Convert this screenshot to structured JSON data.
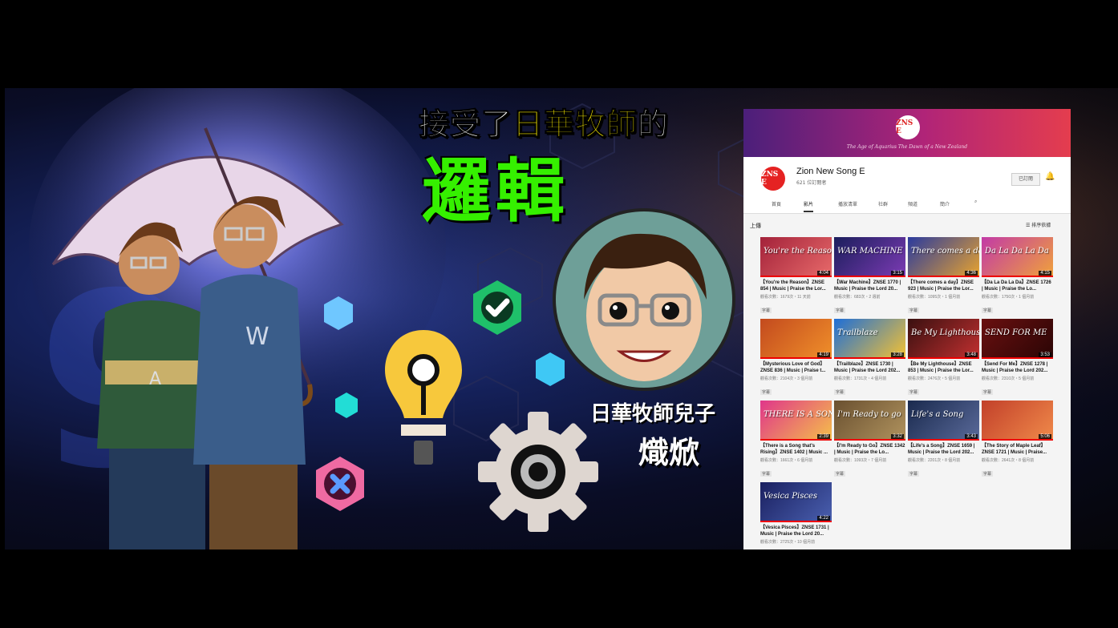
{
  "headline": {
    "part1": "接受了",
    "highlight": "日華牧師",
    "part2": "的",
    "big": "邏輯"
  },
  "creator": {
    "line1": "日華牧師兒子",
    "line2": "熾焮"
  },
  "colors": {
    "headline_highlight": "#f6e800",
    "big_title": "#35f000",
    "check_badge": "#1fc06a",
    "cross_badge": "#ef6aa2",
    "youtube_red": "#e52222"
  },
  "youtube": {
    "banner_logo": "ZNS E",
    "banner_tagline": "The Age of Aquarius  The Dawn of a New Zealand",
    "channel_logo": "ZNS E",
    "channel_name": "Zion New Song E",
    "subscribers": "621 位訂閱者",
    "subscribe_btn": "已訂閱",
    "tabs": [
      "首頁",
      "影片",
      "播放清單",
      "社群",
      "頻道",
      "簡介"
    ],
    "active_tab": "影片",
    "section": "上傳",
    "sort": "排序依據",
    "videos": [
      {
        "title": "【You're the Reason】ZNSE 854 | Music | Praise the Lor...",
        "meta": "觀看次數：1679次・11 天前",
        "duration": "4:04",
        "thumb_text": "You're the Reason",
        "c1": "#a3223a",
        "c2": "#e86a6a"
      },
      {
        "title": "【War Machine】ZNSE 1770 | Music | Praise the Lord 20...",
        "meta": "觀看次數：683次・2 週前",
        "duration": "3:15",
        "thumb_text": "WAR MACHINE",
        "c1": "#1b1e5c",
        "c2": "#7c3bb4"
      },
      {
        "title": "【There comes a day】ZNSE 923 | Music | Praise the Lor...",
        "meta": "觀看次數：1095次・1 個月前",
        "duration": "4:36",
        "thumb_text": "There comes a day",
        "c1": "#2a3a9e",
        "c2": "#e8a32e"
      },
      {
        "title": "【Da La Da La Da】ZNSE 1726 | Music | Praise the Lo...",
        "meta": "觀看次數：1750次・1 個月前",
        "duration": "4:15",
        "thumb_text": "Da La Da La Da",
        "c1": "#c23aa6",
        "c2": "#f0a23a"
      },
      {
        "title": "【Mysterious Love of God】ZNSE 836 | Music | Praise t...",
        "meta": "觀看次數：2104次・3 個月前",
        "duration": "4:19",
        "thumb_text": "",
        "c1": "#c34a1e",
        "c2": "#f0902a"
      },
      {
        "title": "【Trailblaze】ZNSE 1730 | Music | Praise the Lord 202...",
        "meta": "觀看次數：1731次・4 個月前",
        "duration": "3:28",
        "thumb_text": "Trailblaze",
        "c1": "#1d6ed8",
        "c2": "#f5c232"
      },
      {
        "title": "【Be My Lighthouse】ZNSE 853 | Music | Praise the Lor...",
        "meta": "觀看次數：2476次・5 個月前",
        "duration": "3:48",
        "thumb_text": "Be My Lighthouse",
        "c1": "#3a1010",
        "c2": "#c23030"
      },
      {
        "title": "【Send For Me】ZNSE 1278 | Music | Praise the Lord 202...",
        "meta": "觀看次數：2310次・5 個月前",
        "duration": "3:53",
        "thumb_text": "SEND FOR ME",
        "c1": "#6a1010",
        "c2": "#2a0505"
      },
      {
        "title": "【There is a Song that's Rising】ZNSE 1402 | Music ...",
        "meta": "觀看次數：1661次・6 個月前",
        "duration": "2:39",
        "thumb_text": "THERE IS A SONG",
        "c1": "#e0368a",
        "c2": "#f5c04a"
      },
      {
        "title": "【I'm Ready to Go】ZNSE 1342 | Music | Praise the Lo...",
        "meta": "觀看次數：1093次・7 個月前",
        "duration": "3:32",
        "thumb_text": "I'm Ready to go",
        "c1": "#6a5030",
        "c2": "#b0935e"
      },
      {
        "title": "【Life's a Song】ZNSE 1659 | Music | Praise the Lord 202...",
        "meta": "觀看次數：2201次・8 個月前",
        "duration": "3:43",
        "thumb_text": "Life's a Song",
        "c1": "#1a2a4e",
        "c2": "#5a6a9a"
      },
      {
        "title": "【The Story of Maple Leaf】ZNSE 1721 | Music | Praise...",
        "meta": "觀看次數：2641次・8 個月前",
        "duration": "5:06",
        "thumb_text": "",
        "c1": "#c2402a",
        "c2": "#f08a4a"
      },
      {
        "title": "【Vesica Pisces】ZNSE 1731 | Music | Praise the Lord 20...",
        "meta": "觀看次數：2725次・10 個月前",
        "duration": "4:22",
        "thumb_text": "Vesica Pisces",
        "c1": "#1a2060",
        "c2": "#4a60b0"
      }
    ],
    "tag": "字幕"
  }
}
